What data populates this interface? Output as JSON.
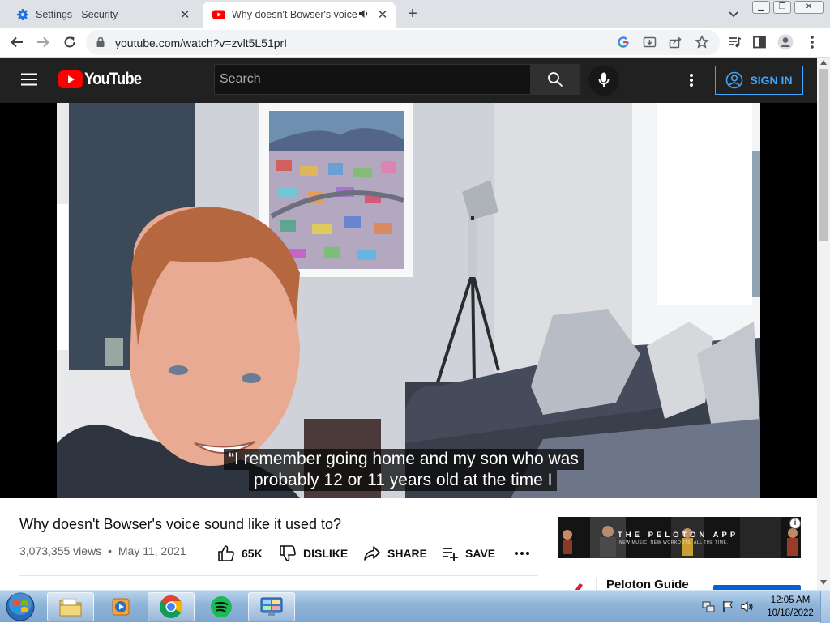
{
  "browser": {
    "tabs": [
      {
        "title": "Settings - Security",
        "favicon": "gear-icon",
        "active": false
      },
      {
        "title": "Why doesn't Bowser's voice",
        "favicon": "youtube-icon",
        "active": true,
        "audio": true
      }
    ],
    "url": "youtube.com/watch?v=zvlt5L51prI",
    "window_controls": [
      "minimize",
      "restore",
      "close"
    ]
  },
  "youtube": {
    "logo_text": "YouTube",
    "search_placeholder": "Search",
    "signin_label": "SIGN IN"
  },
  "video": {
    "caption_lines": [
      "“I remember going home and my son who was",
      "probably 12 or 11 years old at the time I"
    ]
  },
  "details": {
    "title": "Why doesn't Bowser's voice sound like it used to?",
    "views": "3,073,355 views",
    "separator": "•",
    "date": "May 11, 2021",
    "actions": {
      "like": "65K",
      "dislike": "DISLIKE",
      "share": "SHARE",
      "save": "SAVE"
    }
  },
  "sidebar": {
    "ad": {
      "headline": "THE PELOTON APP",
      "tagline": "NEW MUSIC. NEW WORKOUTS. ALL THE TIME.",
      "info_label": "i"
    },
    "next_item_title": "Peloton Guide"
  },
  "taskbar": {
    "apps": [
      "start-orb",
      "file-explorer",
      "media-player",
      "chrome",
      "spotify",
      "control-panel"
    ],
    "time": "12:05 AM",
    "date": "10/18/2022"
  },
  "colors": {
    "yt_header": "#212121",
    "yt_red": "#ff0000",
    "signin_blue": "#3ea6ff",
    "taskbar": "#8fb4d9"
  }
}
